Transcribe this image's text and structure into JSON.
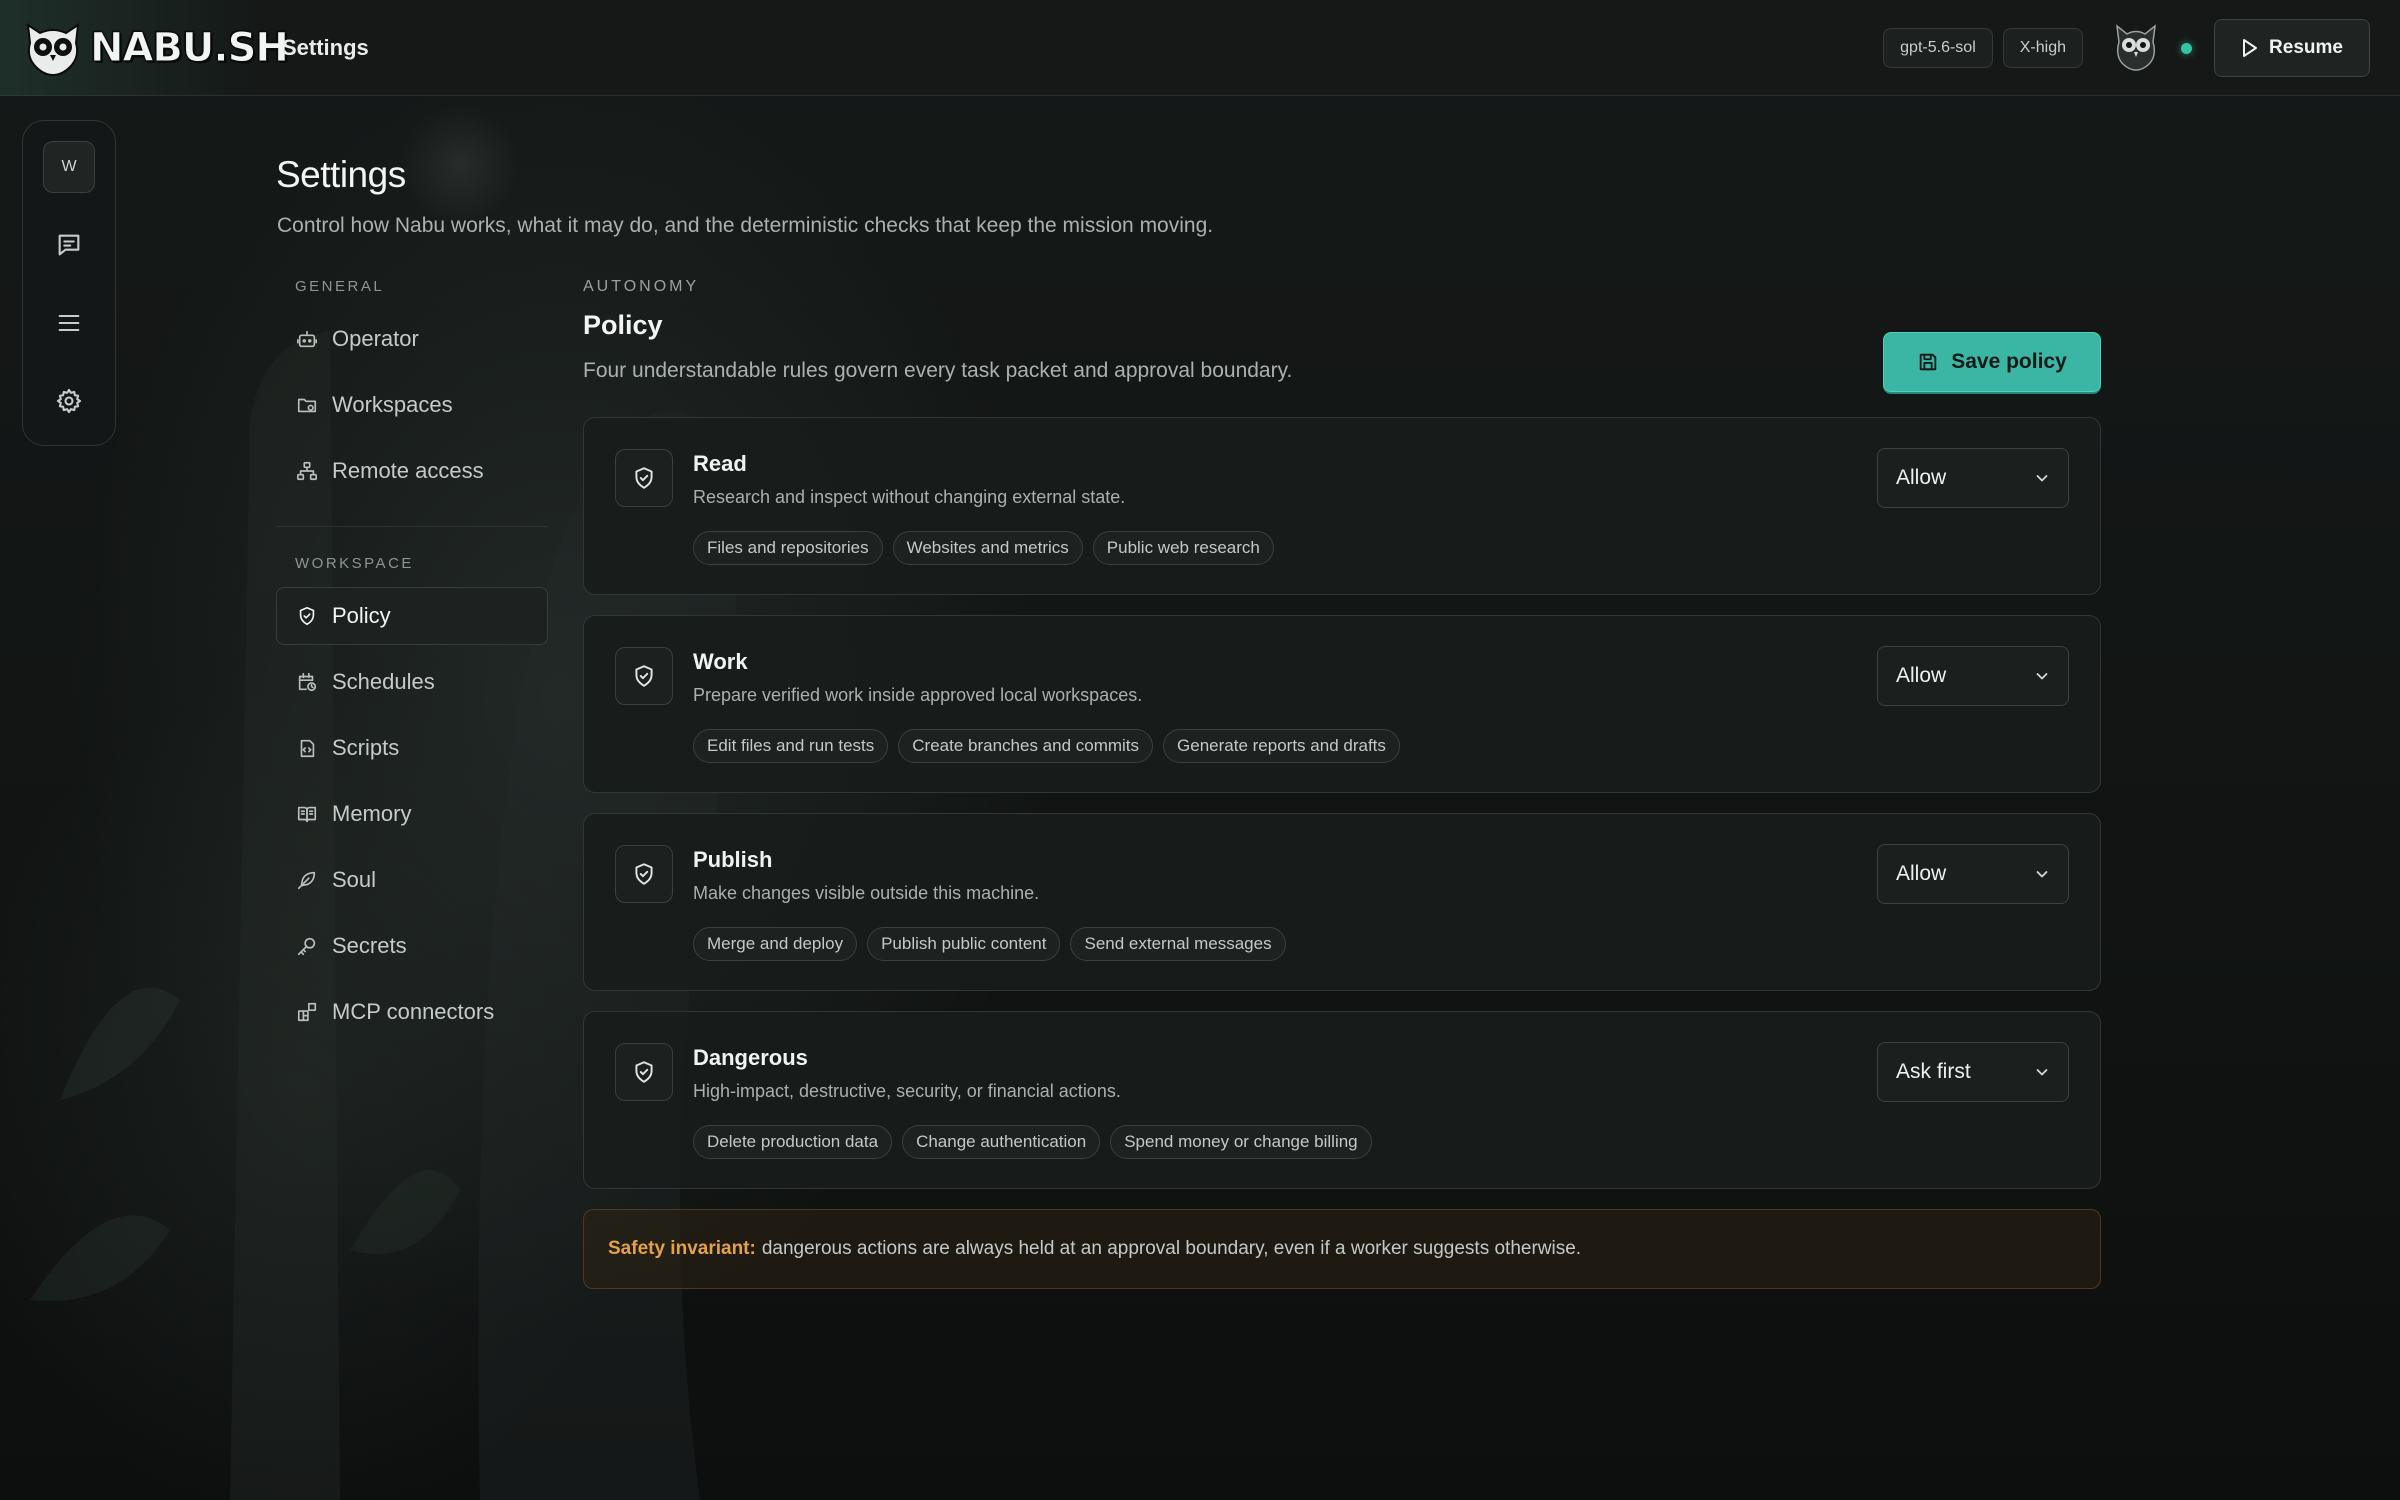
{
  "brand": {
    "name": "NABU.SH"
  },
  "header": {
    "title": "Settings",
    "model_chip": "gpt-5.6-sol",
    "effort_chip": "X-high",
    "resume_label": "Resume",
    "status_color": "#35c3a6"
  },
  "rail": {
    "workspace_initial": "W",
    "items": [
      {
        "icon": "chat-icon"
      },
      {
        "icon": "menu-icon"
      },
      {
        "icon": "gear-icon"
      }
    ]
  },
  "page": {
    "title": "Settings",
    "subtitle": "Control how Nabu works, what it may do, and the deterministic checks that keep the mission moving."
  },
  "nav": {
    "general_label": "GENERAL",
    "general": [
      {
        "label": "Operator",
        "icon": "robot-icon"
      },
      {
        "label": "Workspaces",
        "icon": "folder-icon"
      },
      {
        "label": "Remote access",
        "icon": "network-icon"
      }
    ],
    "workspace_label": "WORKSPACE",
    "workspace": [
      {
        "label": "Policy",
        "icon": "shield-icon",
        "active": true
      },
      {
        "label": "Schedules",
        "icon": "calendar-clock-icon"
      },
      {
        "label": "Scripts",
        "icon": "script-icon"
      },
      {
        "label": "Memory",
        "icon": "book-icon"
      },
      {
        "label": "Soul",
        "icon": "feather-icon"
      },
      {
        "label": "Secrets",
        "icon": "key-icon"
      },
      {
        "label": "MCP connectors",
        "icon": "blocks-icon"
      }
    ]
  },
  "section": {
    "eyebrow": "AUTONOMY",
    "title": "Policy",
    "subtitle": "Four understandable rules govern every task packet and approval boundary.",
    "save_label": "Save policy",
    "accent": "#3cb6a4"
  },
  "policies": [
    {
      "title": "Read",
      "desc": "Research and inspect without changing external state.",
      "tags": [
        "Files and repositories",
        "Websites and metrics",
        "Public web research"
      ],
      "value": "Allow"
    },
    {
      "title": "Work",
      "desc": "Prepare verified work inside approved local workspaces.",
      "tags": [
        "Edit files and run tests",
        "Create branches and commits",
        "Generate reports and drafts"
      ],
      "value": "Allow"
    },
    {
      "title": "Publish",
      "desc": "Make changes visible outside this machine.",
      "tags": [
        "Merge and deploy",
        "Publish public content",
        "Send external messages"
      ],
      "value": "Allow"
    },
    {
      "title": "Dangerous",
      "desc": "High-impact, destructive, security, or financial actions.",
      "tags": [
        "Delete production data",
        "Change authentication",
        "Spend money or change billing"
      ],
      "value": "Ask first"
    }
  ],
  "notice": {
    "lead": "Safety invariant:",
    "text": "dangerous actions are always held at an approval boundary, even if a worker suggests otherwise.",
    "color": "#e3a24a"
  }
}
